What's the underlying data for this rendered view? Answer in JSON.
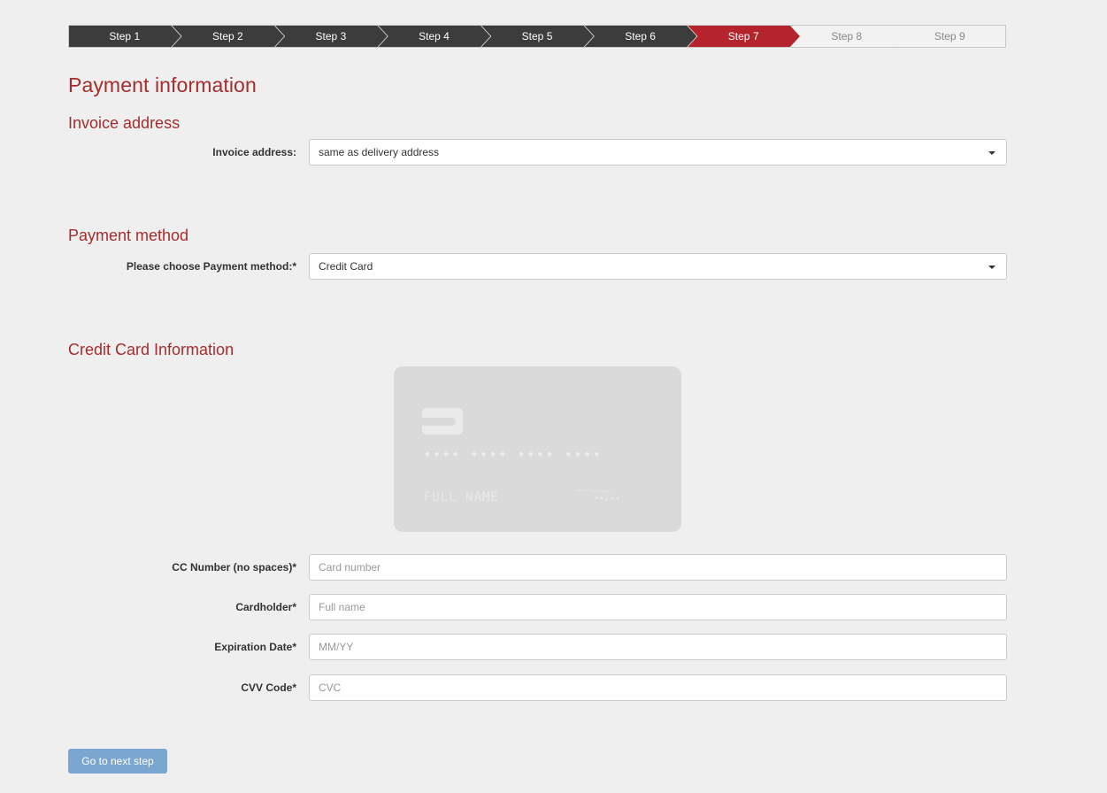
{
  "steps": [
    {
      "label": "Step 1",
      "state": "done"
    },
    {
      "label": "Step 2",
      "state": "done"
    },
    {
      "label": "Step 3",
      "state": "done"
    },
    {
      "label": "Step 4",
      "state": "done"
    },
    {
      "label": "Step 5",
      "state": "done"
    },
    {
      "label": "Step 6",
      "state": "done"
    },
    {
      "label": "Step 7",
      "state": "active"
    },
    {
      "label": "Step 8",
      "state": "todo"
    },
    {
      "label": "Step 9",
      "state": "todo"
    }
  ],
  "page_title": "Payment information",
  "invoice": {
    "heading": "Invoice address",
    "label": "Invoice address:",
    "value": "same as delivery address"
  },
  "payment": {
    "heading": "Payment method",
    "label": "Please choose Payment method:*",
    "value": "Credit Card"
  },
  "credit_card": {
    "heading": "Credit Card Information",
    "card_preview": {
      "number": "•••• •••• •••• ••••",
      "name": "FULL NAME",
      "valid_thru": "valid thru",
      "month_year": "month/year",
      "expiry": "••/••"
    },
    "fields": {
      "number": {
        "label": "CC Number (no spaces)*",
        "placeholder": "Card number"
      },
      "holder": {
        "label": "Cardholder*",
        "placeholder": "Full name"
      },
      "expiry": {
        "label": "Expiration Date*",
        "placeholder": "MM/YY"
      },
      "cvv": {
        "label": "CVV Code*",
        "placeholder": "CVC"
      }
    }
  },
  "next_button": "Go to next step",
  "colors": {
    "accent": "#a52d2d",
    "active_step": "#b5242c",
    "done_step": "#3c3c3c",
    "button": "#7aa6cf"
  }
}
